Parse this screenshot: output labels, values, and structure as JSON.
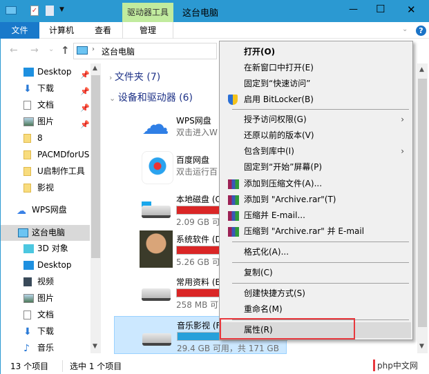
{
  "window": {
    "title": "这台电脑",
    "contextual_tab": "驱动器工具",
    "minimize": "—",
    "maximize": "☐",
    "close": "✕"
  },
  "ribbon": {
    "tabs": [
      "文件",
      "计算机",
      "查看",
      "管理"
    ],
    "help": "?"
  },
  "address": {
    "path": "这台电脑",
    "back": "←",
    "forward": "→",
    "up": "↑"
  },
  "sidebar": {
    "quick_access": [
      {
        "label": "Desktop",
        "pinned": true
      },
      {
        "label": "下载",
        "pinned": true
      },
      {
        "label": "文档",
        "pinned": true
      },
      {
        "label": "图片",
        "pinned": true
      },
      {
        "label": "8"
      },
      {
        "label": "PACMDforUS"
      },
      {
        "label": "U启制作工具"
      },
      {
        "label": "影视"
      }
    ],
    "wps": "WPS网盘",
    "this_pc": "这台电脑",
    "pc_items": [
      "3D 对象",
      "Desktop",
      "视频",
      "图片",
      "文档",
      "下载",
      "音乐"
    ]
  },
  "content": {
    "folders_group": "文件夹 (7)",
    "devices_group": "设备和驱动器 (6)",
    "devices": [
      {
        "name": "WPS网盘",
        "desc": "双击进入W"
      },
      {
        "name": "百度网盘",
        "desc": "双击运行百"
      },
      {
        "name": "本地磁盘 (C",
        "free": "2.09 GB 可",
        "fill": 0.95,
        "color": "#da2626"
      },
      {
        "name": "系统软件 (D",
        "free": "5.26 GB 可",
        "fill": 0.95,
        "color": "#da2626"
      },
      {
        "name": "常用资料 (E",
        "free": "258 MB 可",
        "fill": 0.99,
        "color": "#da2626"
      },
      {
        "name": "音乐影视 (F",
        "free": "29.4 GB 可用，共 171 GB",
        "fill": 0.83,
        "color": "#26a0da"
      }
    ]
  },
  "context_menu": {
    "items": [
      "打开(O)",
      "在新窗口中打开(E)",
      "固定到“快速访问”",
      "启用 BitLocker(B)",
      "授予访问权限(G)",
      "还原以前的版本(V)",
      "包含到库中(I)",
      "固定到“开始”屏幕(P)",
      "添加到压缩文件(A)...",
      "添加到 \"Archive.rar\"(T)",
      "压缩并 E-mail...",
      "压缩到 \"Archive.rar\" 并 E-mail",
      "格式化(A)...",
      "复制(C)",
      "创建快捷方式(S)",
      "重命名(M)",
      "属性(R)"
    ]
  },
  "status": {
    "count": "13 个项目",
    "selected": "选中 1 个项目"
  },
  "watermark": "php中文网"
}
